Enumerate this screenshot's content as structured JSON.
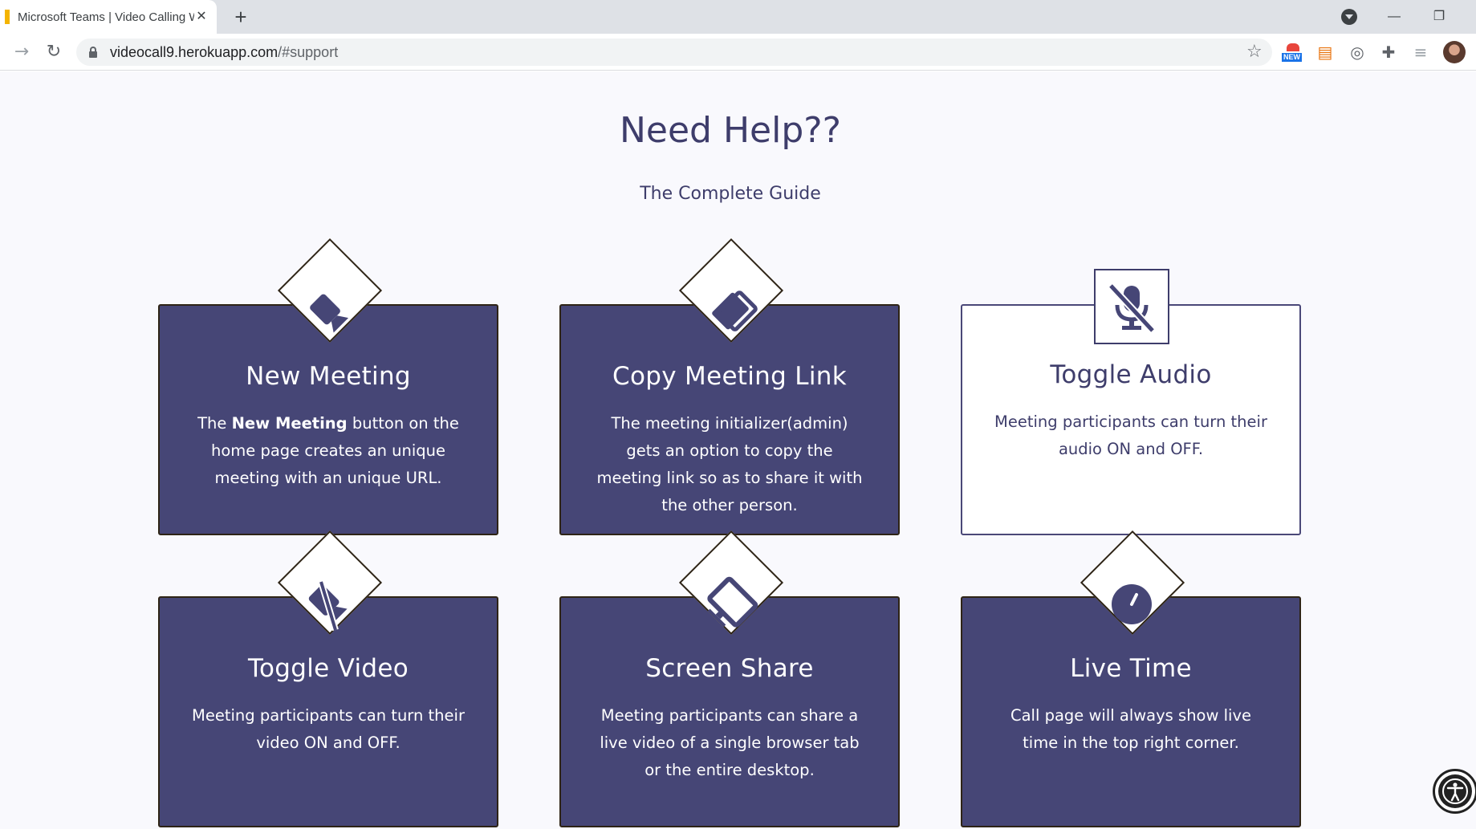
{
  "browser": {
    "tab_title": "Microsoft Teams | Video Calling W",
    "tab_close": "✕",
    "new_tab": "+",
    "url_host": "videocall9.herokuapp.com",
    "url_path": "/#support",
    "ext_new_badge": "NEW",
    "window_minimize": "—",
    "window_restore": "❐"
  },
  "page": {
    "heading": "Need Help??",
    "subheading": "The Complete Guide"
  },
  "cards": [
    {
      "title": "New Meeting",
      "text_before": "The ",
      "text_bold": "New Meeting",
      "text_after": " button on the home page creates an unique meeting with an unique URL.",
      "icon": "video-camera-icon"
    },
    {
      "title": "Copy Meeting Link",
      "text": "The meeting initializer(admin) gets an option to copy the meeting link so as to share it with the other person.",
      "icon": "copy-icon"
    },
    {
      "title": "Toggle Audio",
      "text": "Meeting participants can turn their audio ON and OFF.",
      "icon": "microphone-off-icon"
    },
    {
      "title": "Toggle Video",
      "text": "Meeting participants can turn their video ON and OFF.",
      "icon": "video-off-icon"
    },
    {
      "title": "Screen Share",
      "text": "Meeting participants can share a live video of a single browser tab or the entire desktop.",
      "icon": "screen-share-icon"
    },
    {
      "title": "Live Time",
      "text": "Call page will always show live time in the top right corner.",
      "icon": "clock-icon"
    }
  ],
  "colors": {
    "card_background": "#464676",
    "heading_color": "#3e3d6b",
    "page_background": "#f9f9fd"
  }
}
